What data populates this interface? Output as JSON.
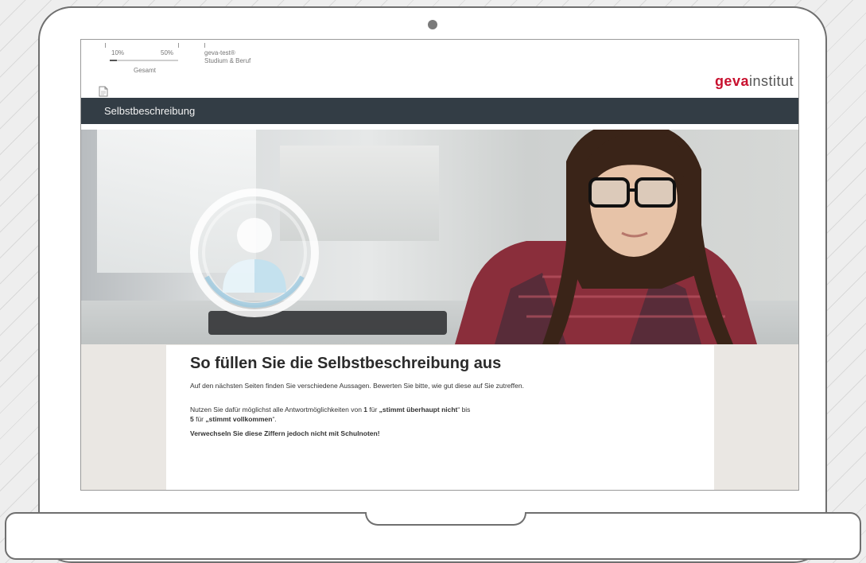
{
  "progress": {
    "pct_left": "10%",
    "pct_right": "50%",
    "label": "Gesamt",
    "fill_fraction": 0.1
  },
  "project": {
    "code": "geva-test®",
    "name": "Studium & Beruf"
  },
  "logo": {
    "bold": "geva",
    "light": "institut",
    "brand_color": "#c8102e"
  },
  "section": {
    "title": "Selbstbeschreibung",
    "bar_color": "#333d45"
  },
  "hero": {
    "icon": "person-circle-icon"
  },
  "instructions": {
    "heading": "So füllen Sie die Selbstbeschreibung aus",
    "p1": "Auf den nächsten Seiten finden Sie verschiedene Aussagen. Bewerten Sie bitte, wie gut diese auf Sie zutreffen.",
    "p2_pre": "Nutzen Sie dafür möglichst alle Antwortmöglichkeiten von ",
    "p2_num1": "1",
    "p2_mid1": " für ",
    "p2_label1": "„stimmt überhaupt nicht",
    "p2_mid2": "“ bis ",
    "p2_num5": "5",
    "p2_mid3": " für ",
    "p2_label5": "„stimmt vollkommen",
    "p2_end": "“.",
    "warning": "Verwechseln Sie diese Ziffern jedoch nicht mit Schulnoten!"
  }
}
